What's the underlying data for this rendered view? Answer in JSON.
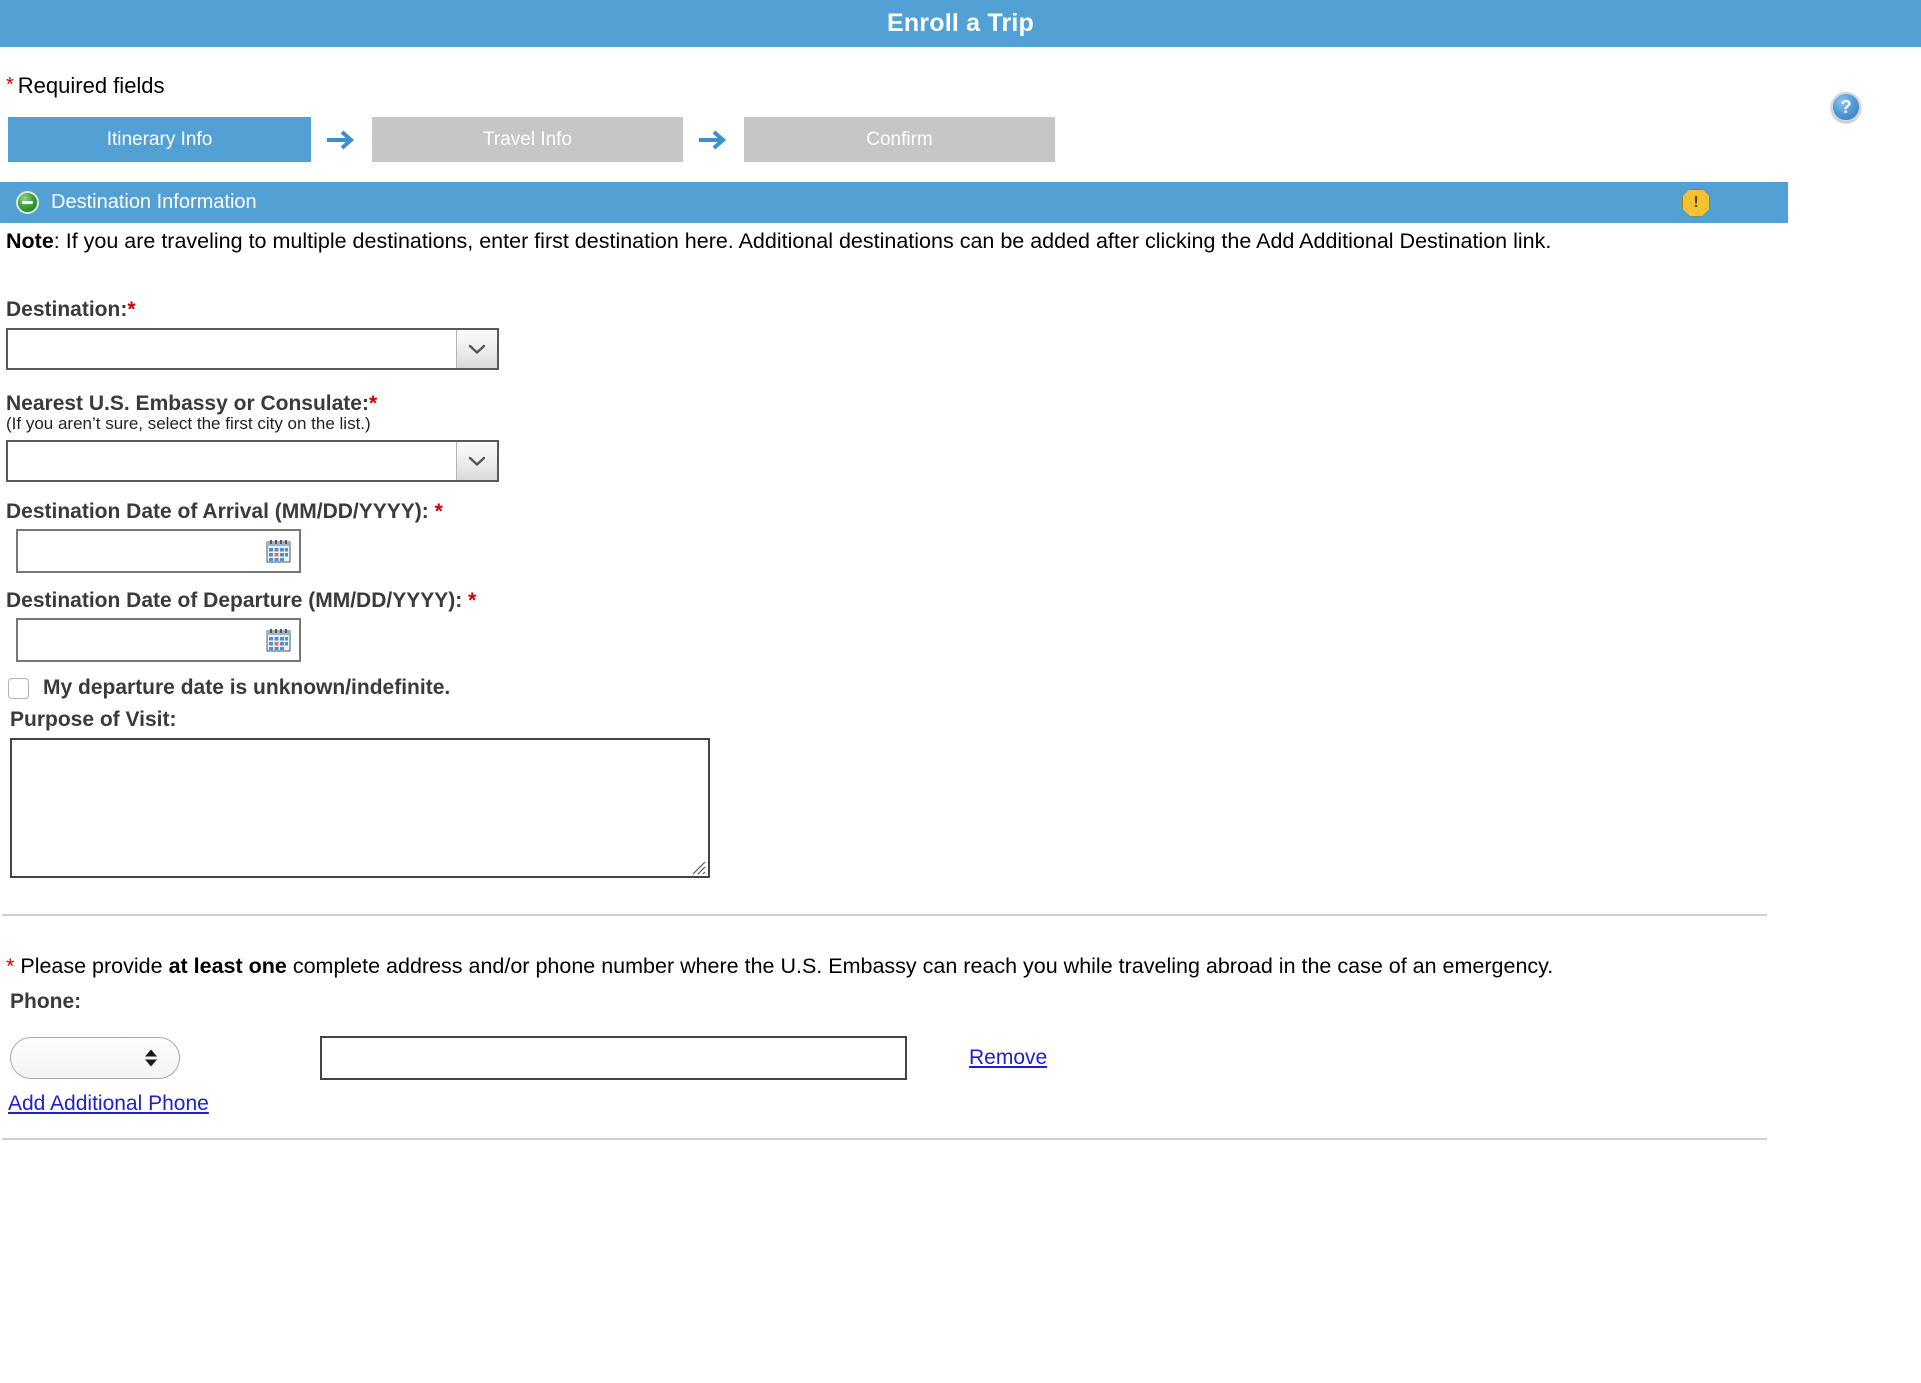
{
  "header": {
    "title": "Enroll a Trip"
  },
  "required_note": {
    "star": "*",
    "text": "Required fields"
  },
  "help": {
    "icon": "help-question-icon",
    "glyph": "?"
  },
  "steps": [
    {
      "label": "Itinerary Info",
      "state": "active"
    },
    {
      "label": "Travel Info",
      "state": "inactive"
    },
    {
      "label": "Confirm",
      "state": "inactive"
    }
  ],
  "section": {
    "title": "Destination Information",
    "collapse_icon": "minus-circle-icon",
    "warning_icon": "warning-octagon-icon",
    "warning_glyph": "!"
  },
  "note": {
    "bold_prefix": "Note",
    "text": ": If you are traveling to multiple destinations, enter first destination here. Additional destinations can be added after clicking the Add Additional Destination link."
  },
  "fields": {
    "destination": {
      "label": "Destination:",
      "star": "*",
      "value": "",
      "placeholder": ""
    },
    "embassy": {
      "label": "Nearest U.S. Embassy or Consulate:",
      "star": "*",
      "sublabel": "(If you aren’t sure, select the first city on the list.)",
      "value": "",
      "placeholder": ""
    },
    "arrival_date": {
      "label": "Destination Date of Arrival (MM/DD/YYYY):",
      "star": "*",
      "value": "",
      "placeholder": "",
      "icon": "calendar-icon"
    },
    "departure_date": {
      "label": "Destination Date of Departure (MM/DD/YYYY):",
      "star": "*",
      "value": "",
      "placeholder": "",
      "icon": "calendar-icon"
    },
    "departure_unknown": {
      "label": "My departure date is unknown/indefinite.",
      "checked": false
    },
    "purpose": {
      "label": "Purpose of Visit:",
      "value": "",
      "placeholder": ""
    }
  },
  "emergency": {
    "star": "*",
    "text_before": " Please provide ",
    "bold": "at least one",
    "text_after": " complete address and/or phone number where the U.S. Embassy can reach you while traveling abroad in the case of an emergency."
  },
  "phone": {
    "label": "Phone:",
    "type_value": "",
    "number_value": "",
    "number_placeholder": "",
    "remove_label": "Remove",
    "add_label": "Add Additional Phone"
  },
  "colors": {
    "brand_blue": "#52a0d4",
    "step_inactive": "#c6c6c6",
    "required_red": "#cc0000",
    "link_blue": "#2020d0",
    "warning_yellow": "#f2c230",
    "collapse_green": "#3aa33a"
  }
}
